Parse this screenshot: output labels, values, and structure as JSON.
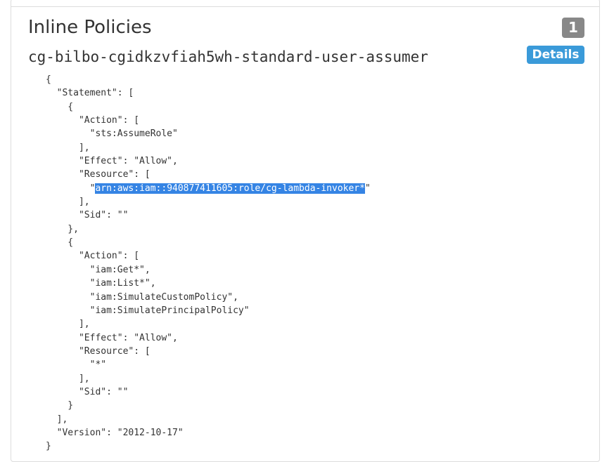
{
  "section": {
    "title": "Inline Policies",
    "count": "1"
  },
  "policy": {
    "name": "cg-bilbo-cgidkzvfiah5wh-standard-user-assumer",
    "details_label": "Details"
  },
  "document": {
    "lines": [
      "{",
      "  \"Statement\": [",
      "    {",
      "      \"Action\": [",
      "        \"sts:AssumeRole\"",
      "      ],",
      "      \"Effect\": \"Allow\",",
      "      \"Resource\": [",
      "        \"",
      "      ],",
      "      \"Sid\": \"\"",
      "    },",
      "    {",
      "      \"Action\": [",
      "        \"iam:Get*\",",
      "        \"iam:List*\",",
      "        \"iam:SimulateCustomPolicy\",",
      "        \"iam:SimulatePrincipalPolicy\"",
      "      ],",
      "      \"Effect\": \"Allow\",",
      "      \"Resource\": [",
      "        \"*\"",
      "      ],",
      "      \"Sid\": \"\"",
      "    }",
      "  ],",
      "  \"Version\": \"2012-10-17\"",
      "}"
    ],
    "selected_text": "arn:aws:iam::940877411605:role/cg-lambda-invoker*",
    "selected_suffix": "\""
  }
}
